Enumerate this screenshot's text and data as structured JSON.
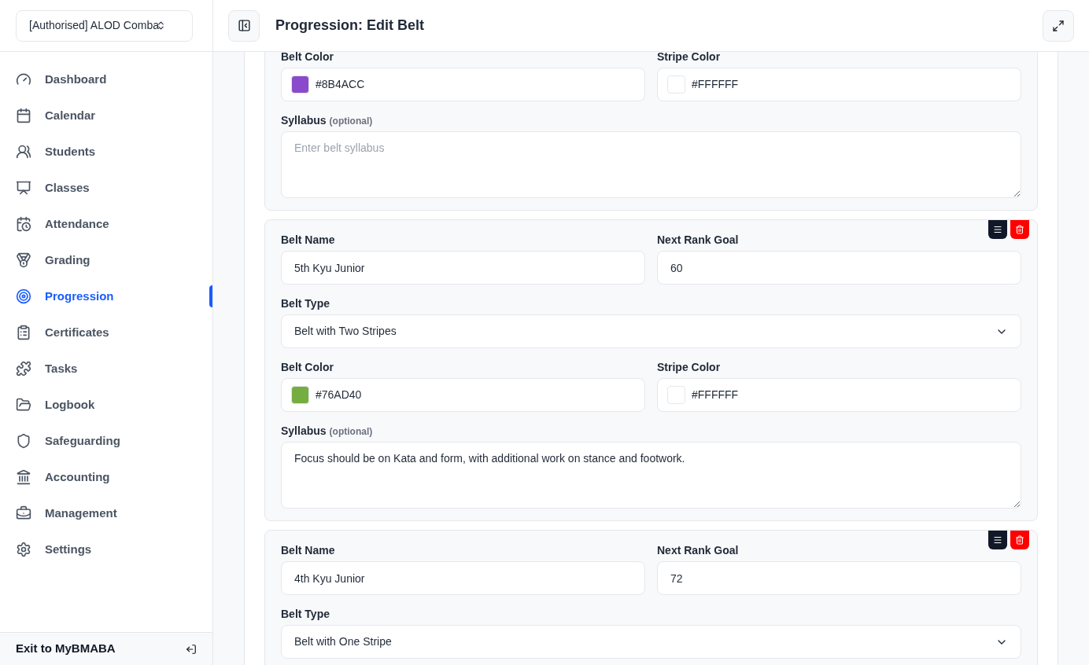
{
  "sidebar": {
    "org_selector": "[Authorised] ALOD Comba",
    "items": [
      {
        "label": "Dashboard",
        "selected": false
      },
      {
        "label": "Calendar",
        "selected": false
      },
      {
        "label": "Students",
        "selected": false
      },
      {
        "label": "Classes",
        "selected": false
      },
      {
        "label": "Attendance",
        "selected": false
      },
      {
        "label": "Grading",
        "selected": false
      },
      {
        "label": "Progression",
        "selected": true
      },
      {
        "label": "Certificates",
        "selected": false
      },
      {
        "label": "Tasks",
        "selected": false
      },
      {
        "label": "Logbook",
        "selected": false
      },
      {
        "label": "Safeguarding",
        "selected": false
      },
      {
        "label": "Accounting",
        "selected": false
      },
      {
        "label": "Management",
        "selected": false
      },
      {
        "label": "Settings",
        "selected": false
      }
    ],
    "exit": "Exit to MyBMABA"
  },
  "header": {
    "title": "Progression: Edit Belt"
  },
  "belts": [
    {
      "actions": false,
      "belt_color": {
        "label": "Belt Color",
        "value": "#8B4ACC",
        "color": "#8b4acc"
      },
      "stripe_color": {
        "label": "Stripe Color",
        "value": "#FFFFFF",
        "color": "#ffffff"
      },
      "syllabus": {
        "label": "Syllabus",
        "hint": "(optional)",
        "placeholder": "Enter belt syllabus"
      }
    },
    {
      "actions": true,
      "belt_name": {
        "label": "Belt Name",
        "value": "5th Kyu Junior"
      },
      "next_rank_goal": {
        "label": "Next Rank Goal",
        "value": "60"
      },
      "belt_type": {
        "label": "Belt Type",
        "value": "Belt with Two Stripes"
      },
      "belt_color": {
        "label": "Belt Color",
        "value": "#76AD40",
        "color": "#76ad40"
      },
      "stripe_color": {
        "label": "Stripe Color",
        "value": "#FFFFFF",
        "color": "#ffffff"
      },
      "syllabus": {
        "label": "Syllabus",
        "hint": "(optional)",
        "value": "Focus should be on Kata and form, with additional work on stance and footwork."
      }
    },
    {
      "actions": true,
      "belt_name": {
        "label": "Belt Name",
        "value": "4th Kyu Junior"
      },
      "next_rank_goal": {
        "label": "Next Rank Goal",
        "value": "72"
      },
      "belt_type": {
        "label": "Belt Type",
        "value": "Belt with One Stripe"
      }
    }
  ]
}
